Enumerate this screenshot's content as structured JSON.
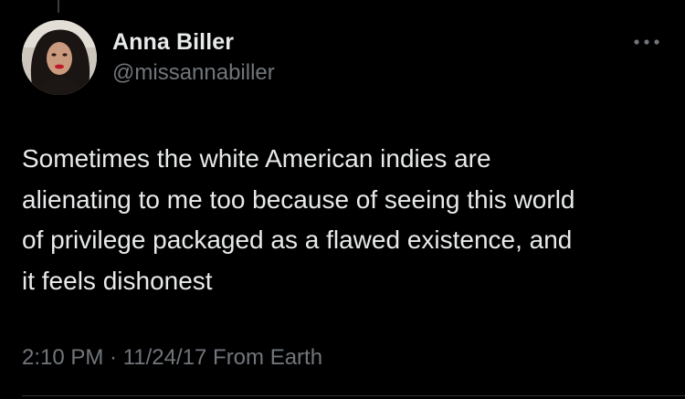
{
  "tweet": {
    "author": {
      "display_name": "Anna Biller",
      "handle": "@missannabiller",
      "avatar_icon": "profile-photo"
    },
    "text": "Sometimes the white American indies are\nalienating to me too because of seeing this world\nof privilege packaged as a flawed existence, and\nit feels dishonest",
    "time": "2:10 PM",
    "separator": " · ",
    "date": "11/24/17",
    "source": "From Earth",
    "more_icon": "more-horizontal-icon"
  },
  "colors": {
    "background": "#000000",
    "primary_text": "#e7e9ea",
    "secondary_text": "#71767b",
    "divider": "#2f3336"
  }
}
